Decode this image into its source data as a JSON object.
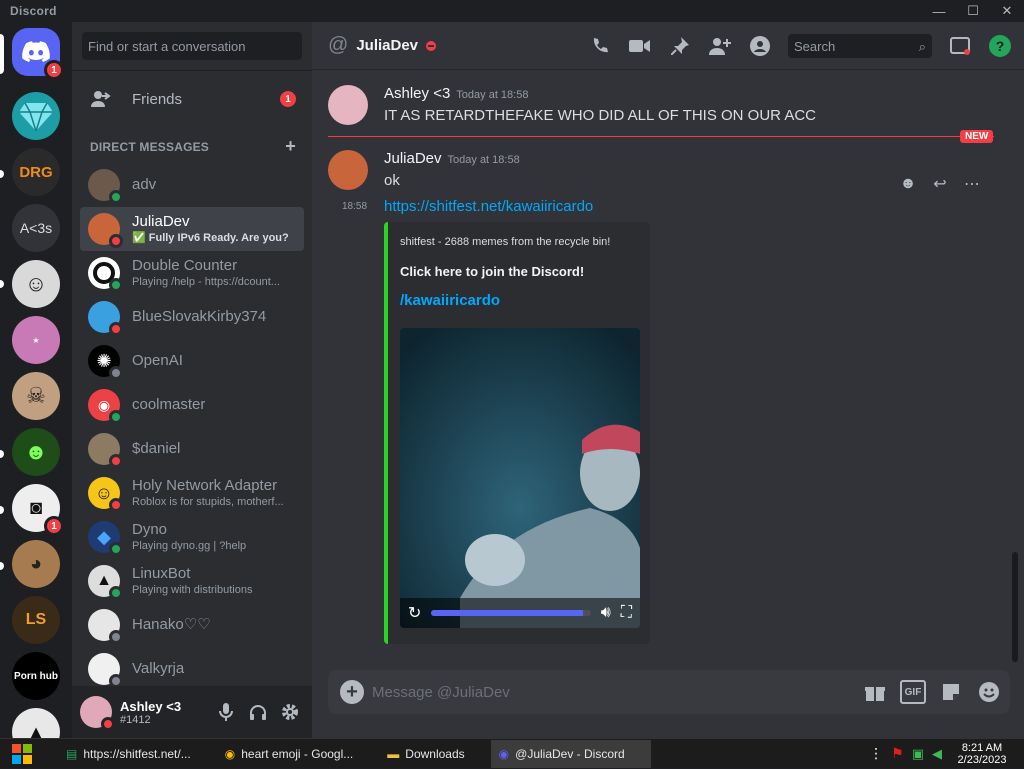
{
  "window": {
    "app_name": "Discord",
    "minimize": "—",
    "maximize": "☐",
    "close": "✕"
  },
  "servers": [
    {
      "label": "",
      "badge": "1"
    },
    {
      "label": ""
    },
    {
      "label": "DRG"
    },
    {
      "label": "A<3s"
    },
    {
      "label": ""
    },
    {
      "label": ""
    },
    {
      "label": ""
    },
    {
      "label": ""
    },
    {
      "label": "",
      "badge": "1"
    },
    {
      "label": ""
    },
    {
      "label": "LS"
    },
    {
      "label": "Porn hub"
    },
    {
      "label": ""
    }
  ],
  "sidebar": {
    "search_placeholder": "Find or start a conversation",
    "friends_label": "Friends",
    "friends_badge": "1",
    "dm_header": "DIRECT MESSAGES",
    "dm_add": "+",
    "dms": [
      {
        "name": "adv",
        "sub": "",
        "status": "online"
      },
      {
        "name": "JuliaDev",
        "sub": "✅ Fully IPv6 Ready. Are you?",
        "status": "dnd"
      },
      {
        "name": "Double Counter",
        "sub": "Playing /help - https://dcount...",
        "status": "online"
      },
      {
        "name": "BlueSlovakKirby374",
        "sub": "",
        "status": "dnd"
      },
      {
        "name": "OpenAI",
        "sub": "",
        "status": "offline"
      },
      {
        "name": "coolmaster",
        "sub": "",
        "status": "online"
      },
      {
        "name": "$daniel",
        "sub": "",
        "status": "dnd"
      },
      {
        "name": "Holy Network Adapter",
        "sub": "Roblox is for stupids, motherf...",
        "status": "dnd"
      },
      {
        "name": "Dyno",
        "sub": "Playing dyno.gg | ?help",
        "status": "online"
      },
      {
        "name": "LinuxBot",
        "sub": "Playing with distributions",
        "status": "online"
      },
      {
        "name": "Hanako♡♡",
        "sub": "",
        "status": "offline"
      },
      {
        "name": "Valkyrja",
        "sub": "",
        "status": "offline"
      }
    ]
  },
  "user_panel": {
    "name": "Ashley <3",
    "tag": "#1412"
  },
  "chat": {
    "header_name": "JuliaDev",
    "search_placeholder": "Search",
    "messages": [
      {
        "author": "Ashley <3",
        "time": "Today at 18:58",
        "text": "IT AS RETARDTHEFAKE WHO DID ALL OF THIS ON OUR ACC"
      },
      {
        "author": "JuliaDev",
        "time": "Today at 18:58",
        "text": "ok"
      }
    ],
    "new_label": "NEW",
    "followup_time": "18:58",
    "link": "https://shitfest.net/kawaiiricardo",
    "embed": {
      "provider": "shitfest - 2688 memes from the recycle bin!",
      "title": "Click here to join the Discord!",
      "link": "/kawaiiricardo",
      "video_progress": 0.95
    },
    "composer_placeholder": "Message @JuliaDev",
    "gif_label": "GIF"
  },
  "taskbar": {
    "tasks": [
      {
        "label": "https://shitfest.net/..."
      },
      {
        "label": "heart emoji - Googl..."
      },
      {
        "label": "Downloads"
      },
      {
        "label": "@JuliaDev - Discord"
      }
    ],
    "time": "8:21 AM",
    "date": "2/23/2023"
  },
  "colors": {
    "accent": "#5865f2",
    "embed_bar": "#2dd323",
    "danger": "#f23f43",
    "online": "#23a55a",
    "link": "#00a8fc"
  }
}
